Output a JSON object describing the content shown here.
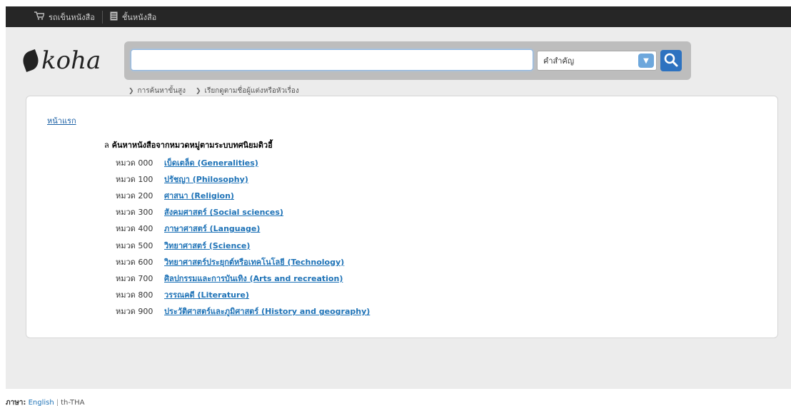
{
  "topbar": {
    "cart_label": "รถเข็นหนังสือ",
    "lists_label": "ชั้นหนังสือ",
    "cart_icon": "cart-icon",
    "lists_icon": "list-icon"
  },
  "logo": {
    "text": "koha"
  },
  "search": {
    "value": "",
    "selected_option": "คำสำคัญ",
    "links": [
      "การค้นหาขั้นสูง",
      "เรียกดูตามชื่อผู้แต่งหรือหัวเรื่อง"
    ]
  },
  "content": {
    "home_link": "หน้าแรก",
    "heading_lead": "ล",
    "heading": "ค้นหาหนังสือจากหมวดหมู่ตามระบบทศนิยมดิวอี้",
    "categories": [
      {
        "code": "หมวด 000",
        "label": "เบ็ดเตล็ด (Generalities)"
      },
      {
        "code": "หมวด 100",
        "label": "ปรัชญา (Philosophy)"
      },
      {
        "code": "หมวด 200",
        "label": "ศาสนา (Religion)"
      },
      {
        "code": "หมวด 300",
        "label": "สังคมศาสตร์ (Social sciences)"
      },
      {
        "code": "หมวด 400",
        "label": "ภาษาศาสตร์ (Language)"
      },
      {
        "code": "หมวด 500",
        "label": "วิทยาศาสตร์ (Science)"
      },
      {
        "code": "หมวด 600",
        "label": "วิทยาศาสตร์ประยุกต์หรือเทคโนโลยี (Technology)"
      },
      {
        "code": "หมวด 700",
        "label": "ศิลปกรรมและการบันเทิง (Arts and recreation)"
      },
      {
        "code": "หมวด 800",
        "label": "วรรณคดี (Literature)"
      },
      {
        "code": "หมวด 900",
        "label": "ประวัติศาสตร์และภูมิศาสตร์ (History and geography)"
      }
    ]
  },
  "footer": {
    "language_label": "ภาษา:",
    "lang_english": "English",
    "lang_current": "th-THA"
  },
  "colors": {
    "topbar": "#262626",
    "link": "#1f73b7",
    "search_button": "#2d72c0"
  }
}
